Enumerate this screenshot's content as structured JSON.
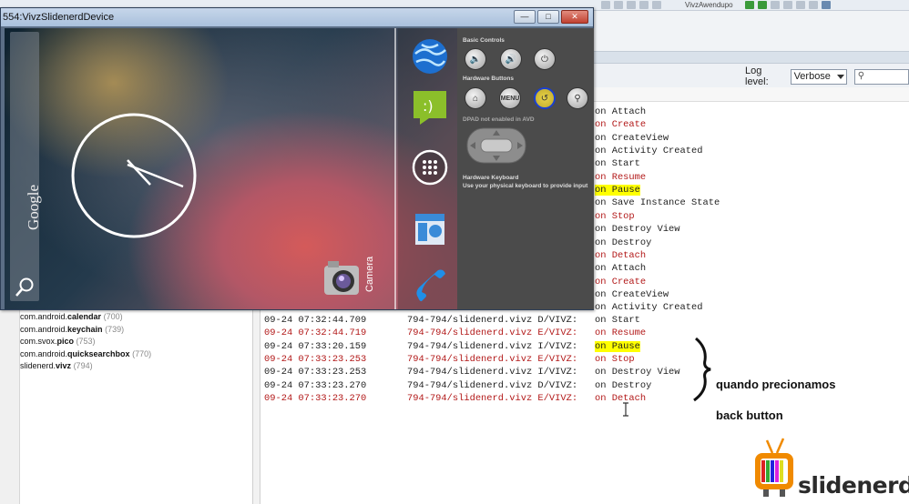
{
  "emulator": {
    "title": "554:VivzSlidenerdDevice",
    "home_screen": {
      "search_brand": "Google",
      "camera_label": "Camera"
    },
    "controls": {
      "basic_title": "Basic Controls",
      "hardware_title": "Hardware Buttons",
      "menu_label": "MENU",
      "dpad_note": "DPAD not enabled in AVD",
      "keyboard_title": "Hardware Keyboard",
      "keyboard_note": "Use your physical keyboard to provide input"
    }
  },
  "ide": {
    "tab_fragment": "VivzAwendupo",
    "log_level_label": "Log level:",
    "log_level_value": "Verbose",
    "search_placeholder": ""
  },
  "processes": [
    {
      "prefix": "com.android.",
      "name": "calendar",
      "pid": "(700)"
    },
    {
      "prefix": "com.android.",
      "name": "keychain",
      "pid": "(739)"
    },
    {
      "prefix": "com.svox.",
      "name": "pico",
      "pid": "(753)"
    },
    {
      "prefix": "com.android.",
      "name": "quicksearchbox",
      "pid": "(770)"
    },
    {
      "prefix": "slidenerd.",
      "name": "vivz",
      "pid": "(794)"
    }
  ],
  "log_upper": [
    {
      "text": "on Attach",
      "level": "debug",
      "hl": false
    },
    {
      "text": "on Create",
      "level": "error",
      "hl": false
    },
    {
      "text": "on CreateView",
      "level": "debug",
      "hl": false
    },
    {
      "text": "on Activity Created",
      "level": "debug",
      "hl": false
    },
    {
      "text": "on Start",
      "level": "debug",
      "hl": false
    },
    {
      "text": "on Resume",
      "level": "error",
      "hl": false
    },
    {
      "text": "on Pause",
      "level": "debug",
      "hl": true
    },
    {
      "text": "on Save Instance State",
      "level": "debug",
      "hl": false
    },
    {
      "text": "on Stop",
      "level": "error",
      "hl": false
    },
    {
      "text": "on Destroy View",
      "level": "debug",
      "hl": false
    },
    {
      "text": "on Destroy",
      "level": "debug",
      "hl": false
    },
    {
      "text": "on Detach",
      "level": "error",
      "hl": false
    },
    {
      "text": "on Attach",
      "level": "debug",
      "hl": false
    },
    {
      "text": "on Create",
      "level": "error",
      "hl": false
    },
    {
      "text": "on CreateView",
      "level": "debug",
      "hl": false
    },
    {
      "text": "on Activity Created",
      "level": "debug",
      "hl": false
    }
  ],
  "log_lower": [
    {
      "time": "09-24 07:32:44.709",
      "source": "794-794/slidenerd.vivz D/VIVZ:",
      "msg": "on Start",
      "level": "debug",
      "hl": false
    },
    {
      "time": "09-24 07:32:44.719",
      "source": "794-794/slidenerd.vivz E/VIVZ:",
      "msg": "on Resume",
      "level": "error",
      "hl": false
    },
    {
      "time": "09-24 07:33:20.159",
      "source": "794-794/slidenerd.vivz I/VIVZ:",
      "msg": "on Pause",
      "level": "debug",
      "hl": true
    },
    {
      "time": "09-24 07:33:23.253",
      "source": "794-794/slidenerd.vivz E/VIVZ:",
      "msg": "on Stop",
      "level": "error",
      "hl": false
    },
    {
      "time": "09-24 07:33:23.253",
      "source": "794-794/slidenerd.vivz I/VIVZ:",
      "msg": "on Destroy View",
      "level": "debug",
      "hl": false
    },
    {
      "time": "09-24 07:33:23.270",
      "source": "794-794/slidenerd.vivz D/VIVZ:",
      "msg": "on Destroy",
      "level": "debug",
      "hl": false
    },
    {
      "time": "09-24 07:33:23.270",
      "source": "794-794/slidenerd.vivz E/VIVZ:",
      "msg": "on Detach",
      "level": "error",
      "hl": false
    }
  ],
  "annotation": {
    "line1": "quando precionamos",
    "line2": "back button"
  },
  "logo": {
    "wordmark": "slidenerd"
  },
  "colors": {
    "highlight": "#ffff00",
    "log_error": "#b21818",
    "log_debug": "#1f1f1f"
  }
}
